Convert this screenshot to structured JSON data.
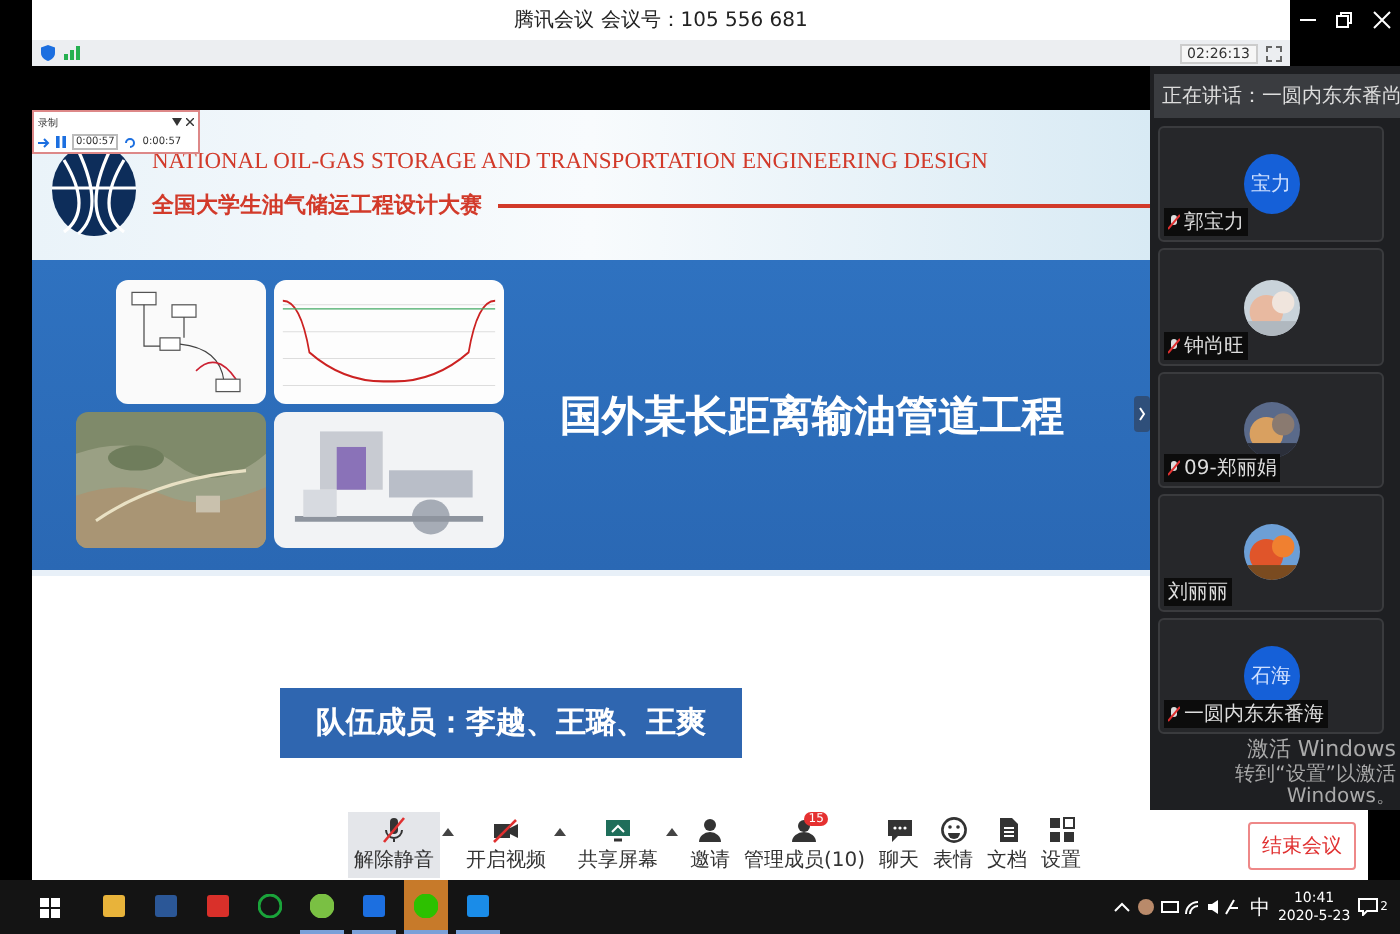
{
  "window": {
    "title": "腾讯会议 会议号：105 556 681",
    "timer": "02:26:13"
  },
  "recorder": {
    "title": "录制",
    "elapsed": "0:00:57",
    "total": "0:00:57"
  },
  "slide": {
    "heading_en": "NATIONAL OIL-GAS STORAGE AND TRANSPORTATION ENGINEERING DESIGN",
    "heading_cn": "全国大学生油气储运工程设计大赛",
    "title": "国外某长距离输油管道工程",
    "members": "队伍成员：李越、王璐、王爽"
  },
  "speaking": "正在讲话：一圆内东东番尚",
  "participants": [
    {
      "name": "郭宝力",
      "avatar_text": "宝力",
      "kind": "initials",
      "muted": true
    },
    {
      "name": "钟尚旺",
      "kind": "picture",
      "muted": true
    },
    {
      "name": "09-郑丽娟",
      "kind": "picture",
      "muted": true
    },
    {
      "name": "刘丽丽",
      "kind": "picture",
      "muted": false
    },
    {
      "name": "一圆内东东番海",
      "avatar_text": "石海",
      "kind": "initials",
      "muted": true
    }
  ],
  "toolbar": [
    {
      "label": "解除静音",
      "caret": true,
      "selected": true
    },
    {
      "label": "开启视频",
      "caret": true,
      "selected": false
    },
    {
      "label": "共享屏幕",
      "caret": true,
      "selected": false
    },
    {
      "label": "邀请",
      "caret": false,
      "selected": false
    },
    {
      "label": "管理成员(10)",
      "caret": false,
      "selected": false,
      "badge": "15"
    },
    {
      "label": "聊天",
      "caret": false,
      "selected": false
    },
    {
      "label": "表情",
      "caret": false,
      "selected": false
    },
    {
      "label": "文档",
      "caret": false,
      "selected": false
    },
    {
      "label": "设置",
      "caret": false,
      "selected": false
    }
  ],
  "end_button": "结束会议",
  "activation": {
    "title": "激活 Windows",
    "hint": "转到“设置”以激活 Windows。"
  },
  "taskbar": {
    "apps": [
      {
        "kind": "folder",
        "active": false
      },
      {
        "kind": "word",
        "active": false
      },
      {
        "kind": "red",
        "active": false
      },
      {
        "kind": "ring",
        "active": false
      },
      {
        "kind": "green",
        "active": true
      },
      {
        "kind": "meeting",
        "active": true
      },
      {
        "kind": "wechat",
        "active": true,
        "selected": true
      },
      {
        "kind": "blue",
        "active": true
      }
    ],
    "ime": "中",
    "time": "10:41",
    "date": "2020-5-23",
    "notifications": "2"
  }
}
